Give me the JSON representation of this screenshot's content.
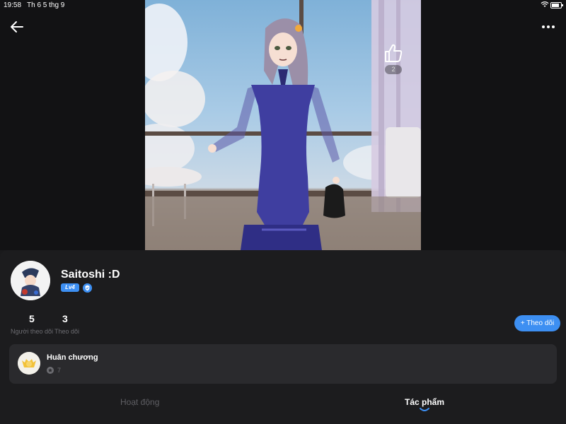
{
  "status_bar": {
    "time": "19:58",
    "date": "Th 6 5 thg 9",
    "battery_level": 0.8
  },
  "header": {
    "back_icon": "arrow-left-icon",
    "more_icon": "more-horizontal-icon"
  },
  "artwork": {
    "like_icon": "thumbs-up-icon",
    "like_count": "2"
  },
  "profile": {
    "username": "Saitoshi :D",
    "level": "Lv4",
    "verified_icon": "shield-check-icon"
  },
  "stats": {
    "followers": {
      "value": "5",
      "label": "Người theo dõi"
    },
    "following": {
      "value": "3",
      "label": "Theo dõi"
    }
  },
  "follow_button": {
    "label": "+ Theo dõi"
  },
  "medal": {
    "title": "Huân chương",
    "count": "7",
    "icon": "medal-icon"
  },
  "tabs": [
    {
      "label": "Hoạt động",
      "active": false
    },
    {
      "label": "Tác phẩm",
      "active": true
    }
  ],
  "colors": {
    "accent": "#3d8ff2",
    "background": "#1c1c1e",
    "card": "#2a2a2d",
    "muted_text": "#6d6d72"
  }
}
